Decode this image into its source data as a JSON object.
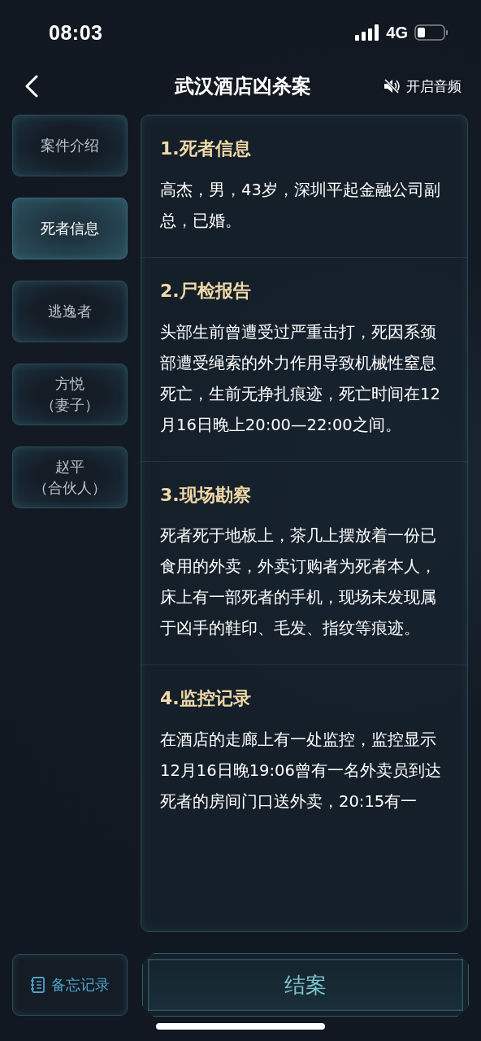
{
  "status_bar": {
    "time": "08:03",
    "network": "4G"
  },
  "header": {
    "title": "武汉酒店凶杀案",
    "audio_label": "开启音频"
  },
  "sidebar": {
    "items": [
      {
        "label": "案件介绍",
        "selected": false
      },
      {
        "label": "死者信息",
        "selected": true
      },
      {
        "label": "逃逸者",
        "selected": false
      },
      {
        "label": "方悦",
        "note": "（妻子）",
        "selected": false
      },
      {
        "label": "赵平",
        "note": "（合伙人）",
        "selected": false
      }
    ]
  },
  "sections": [
    {
      "title": "1.死者信息",
      "body": "高杰，男，43岁，深圳平起金融公司副总，已婚。"
    },
    {
      "title": "2.尸检报告",
      "body": "头部生前曾遭受过严重击打，死因系颈部遭受绳索的外力作用导致机械性窒息死亡，生前无挣扎痕迹，死亡时间在12月16日晚上20:00—22:00之间。"
    },
    {
      "title": "3.现场勘察",
      "body": "死者死于地板上，茶几上摆放着一份已食用的外卖，外卖订购者为死者本人，床上有一部死者的手机，现场未发现属于凶手的鞋印、毛发、指纹等痕迹。"
    },
    {
      "title": "4.监控记录",
      "body": "在酒店的走廊上有一处监控，监控显示12月16日晚19:06曾有一名外卖员到达死者的房间门口送外卖，20:15有一"
    }
  ],
  "footer": {
    "memo_label": "备忘记录",
    "close_label": "结案"
  }
}
